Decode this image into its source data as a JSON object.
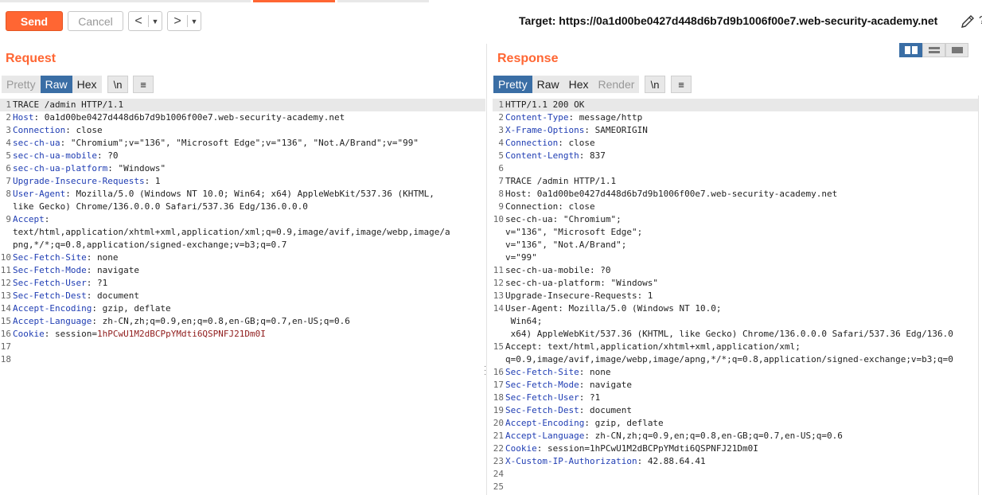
{
  "toolbar": {
    "send_label": "Send",
    "cancel_label": "Cancel",
    "back_glyph": "<",
    "forward_glyph": ">",
    "dropdown_glyph": "▼",
    "target_label": "Target: https://0a1d00be0427d448d6b7d9b1006f00e7.web-security-academy.net"
  },
  "request": {
    "title": "Request",
    "tabs": [
      "Pretty",
      "Raw",
      "Hex"
    ],
    "newline_label": "\\n",
    "menu_glyph": "≡",
    "line_numbers": [
      "1",
      "2",
      "3",
      "4",
      "5",
      "6",
      "7",
      "8",
      "",
      "9",
      "",
      "",
      "10",
      "11",
      "12",
      "13",
      "14",
      "15",
      "16",
      "17",
      "18"
    ],
    "lines": [
      [
        "TRACE /admin HTTP/1.1"
      ],
      [
        "Host",
        ": 0a1d00be0427d448d6b7d9b1006f00e7.web-security-academy.net"
      ],
      [
        "Connection",
        ": close"
      ],
      [
        "sec-ch-ua",
        ": \"Chromium\";v=\"136\", \"Microsoft Edge\";v=\"136\", \"Not.A/Brand\";v=\"99\""
      ],
      [
        "sec-ch-ua-mobile",
        ": ?0"
      ],
      [
        "sec-ch-ua-platform",
        ": \"Windows\""
      ],
      [
        "Upgrade-Insecure-Requests",
        ": 1"
      ],
      [
        "User-Agent",
        ": Mozilla/5.0 (Windows NT 10.0; Win64; x64) AppleWebKit/537.36 (KHTML,"
      ],
      [
        "like Gecko) Chrome/136.0.0.0 Safari/537.36 Edg/136.0.0.0"
      ],
      [
        "Accept",
        ":"
      ],
      [
        "text/html,application/xhtml+xml,application/xml;q=0.9,image/avif,image/webp,image/a"
      ],
      [
        "png,*/*;q=0.8,application/signed-exchange;v=b3;q=0.7"
      ],
      [
        "Sec-Fetch-Site",
        ": none"
      ],
      [
        "Sec-Fetch-Mode",
        ": navigate"
      ],
      [
        "Sec-Fetch-User",
        ": ?1"
      ],
      [
        "Sec-Fetch-Dest",
        ": document"
      ],
      [
        "Accept-Encoding",
        ": gzip, deflate"
      ],
      [
        "Accept-Language",
        ": zh-CN,zh;q=0.9,en;q=0.8,en-GB;q=0.7,en-US;q=0.6"
      ],
      [
        "Cookie",
        ": session=",
        "1hPCwU1M2dBCPpYMdti6QSPNFJ21Dm0I"
      ],
      [
        ""
      ],
      [
        ""
      ]
    ]
  },
  "response": {
    "title": "Response",
    "tabs": [
      "Pretty",
      "Raw",
      "Hex",
      "Render"
    ],
    "newline_label": "\\n",
    "menu_glyph": "≡",
    "line_numbers": [
      "1",
      "2",
      "3",
      "4",
      "5",
      "6",
      "7",
      "8",
      "9",
      "10",
      "",
      "",
      "",
      "11",
      "12",
      "13",
      "14",
      "",
      "",
      "15",
      "",
      "16",
      "17",
      "18",
      "19",
      "20",
      "21",
      "22",
      "23",
      "24",
      "25"
    ],
    "lines": [
      [
        "HTTP/1.1 200 OK"
      ],
      [
        "Content-Type",
        ": message/http"
      ],
      [
        "X-Frame-Options",
        ": SAMEORIGIN"
      ],
      [
        "Connection",
        ": close"
      ],
      [
        "Content-Length",
        ": 837"
      ],
      [
        ""
      ],
      [
        "TRACE /admin HTTP/1.1"
      ],
      [
        "Host: 0a1d00be0427d448d6b7d9b1006f00e7.web-security-academy.net"
      ],
      [
        "Connection: close"
      ],
      [
        "sec-ch-ua: \"Chromium\";"
      ],
      [
        "v=\"136\", \"Microsoft Edge\";"
      ],
      [
        "v=\"136\", \"Not.A/Brand\";"
      ],
      [
        "v=\"99\""
      ],
      [
        "sec-ch-ua-mobile: ?0"
      ],
      [
        "sec-ch-ua-platform: \"Windows\""
      ],
      [
        "Upgrade-Insecure-Requests: 1"
      ],
      [
        "User-Agent: Mozilla/5.0 (Windows NT 10.0;"
      ],
      [
        " Win64;"
      ],
      [
        " x64) AppleWebKit/537.36 (KHTML, like Gecko) Chrome/136.0.0.0 Safari/537.36 Edg/136.0"
      ],
      [
        "Accept: text/html,application/xhtml+xml,application/xml;"
      ],
      [
        "q=0.9,image/avif,image/webp,image/apng,*/*;q=0.8,application/signed-exchange;v=b3;q=0"
      ],
      [
        "Sec-Fetch-Site",
        ": none"
      ],
      [
        "Sec-Fetch-Mode",
        ": navigate"
      ],
      [
        "Sec-Fetch-User",
        ": ?1"
      ],
      [
        "Sec-Fetch-Dest",
        ": document"
      ],
      [
        "Accept-Encoding",
        ": gzip, deflate"
      ],
      [
        "Accept-Language",
        ": zh-CN,zh;q=0.9,en;q=0.8,en-GB;q=0.7,en-US;q=0.6"
      ],
      [
        "Cookie",
        ": session=1hPCwU1M2dBCPpYMdti6QSPNFJ21Dm0I"
      ],
      [
        "X-Custom-IP-Authorization",
        ": 42.88.64.41"
      ],
      [
        ""
      ],
      [
        ""
      ]
    ]
  },
  "colors": {
    "accent": "#ff6633",
    "active_tab": "#3a6ea5",
    "header_key": "#1f3db3",
    "cookie_value": "#8f1b1b"
  }
}
